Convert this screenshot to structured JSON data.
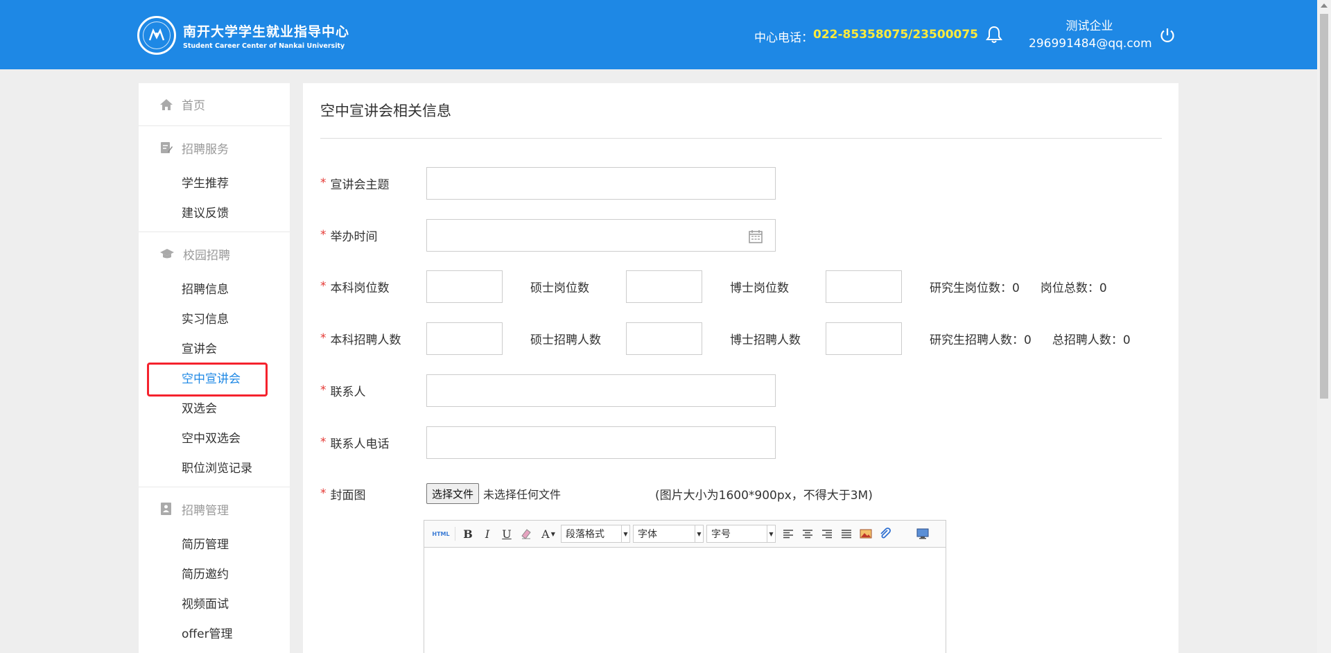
{
  "header": {
    "logo_cn": "南开大学学生就业指导中心",
    "logo_en": "Student Career Center of Nankai University",
    "phone_label": "中心电话：",
    "phone_number": "022-85358075/23500075",
    "user_name": "测试企业",
    "user_email": "296991484@qq.com"
  },
  "sidebar": {
    "home": "首页",
    "groups": [
      {
        "title": "招聘服务",
        "icon": "edit-icon",
        "items": [
          "学生推荐",
          "建议反馈"
        ]
      },
      {
        "title": "校园招聘",
        "icon": "graduation-cap-icon",
        "items": [
          "招聘信息",
          "实习信息",
          "宣讲会",
          "空中宣讲会",
          "双选会",
          "空中双选会",
          "职位浏览记录"
        ]
      },
      {
        "title": "招聘管理",
        "icon": "resume-icon",
        "items": [
          "简历管理",
          "简历邀约",
          "视频面试",
          "offer管理"
        ]
      }
    ],
    "active_item": "空中宣讲会"
  },
  "main": {
    "title": "空中宣讲会相关信息",
    "form": {
      "topic_label": "宣讲会主题",
      "time_label": "举办时间",
      "undergrad_positions_label": "本科岗位数",
      "master_positions_label": "硕士岗位数",
      "phd_positions_label": "博士岗位数",
      "grad_positions_stat": "研究生岗位数：0",
      "total_positions_stat": "岗位总数：0",
      "undergrad_hires_label": "本科招聘人数",
      "master_hires_label": "硕士招聘人数",
      "phd_hires_label": "博士招聘人数",
      "grad_hires_stat": "研究生招聘人数：0",
      "total_hires_stat": "总招聘人数：0",
      "contact_label": "联系人",
      "contact_phone_label": "联系人电话",
      "cover_label": "封面图",
      "file_button": "选择文件",
      "file_status": "未选择任何文件",
      "file_hint": "(图片大小为1600*900px，不得大于3M)",
      "required_mark": "*"
    },
    "editor": {
      "html_btn": "HTML",
      "bold": "B",
      "italic": "I",
      "underline": "U",
      "font_color": "A",
      "paragraph_select": "段落格式",
      "font_select": "字体",
      "size_select": "字号"
    }
  },
  "colors": {
    "primary": "#1e88e5",
    "highlight": "#ffeb3b",
    "required": "#e53935",
    "annotation": "#f5222d"
  }
}
